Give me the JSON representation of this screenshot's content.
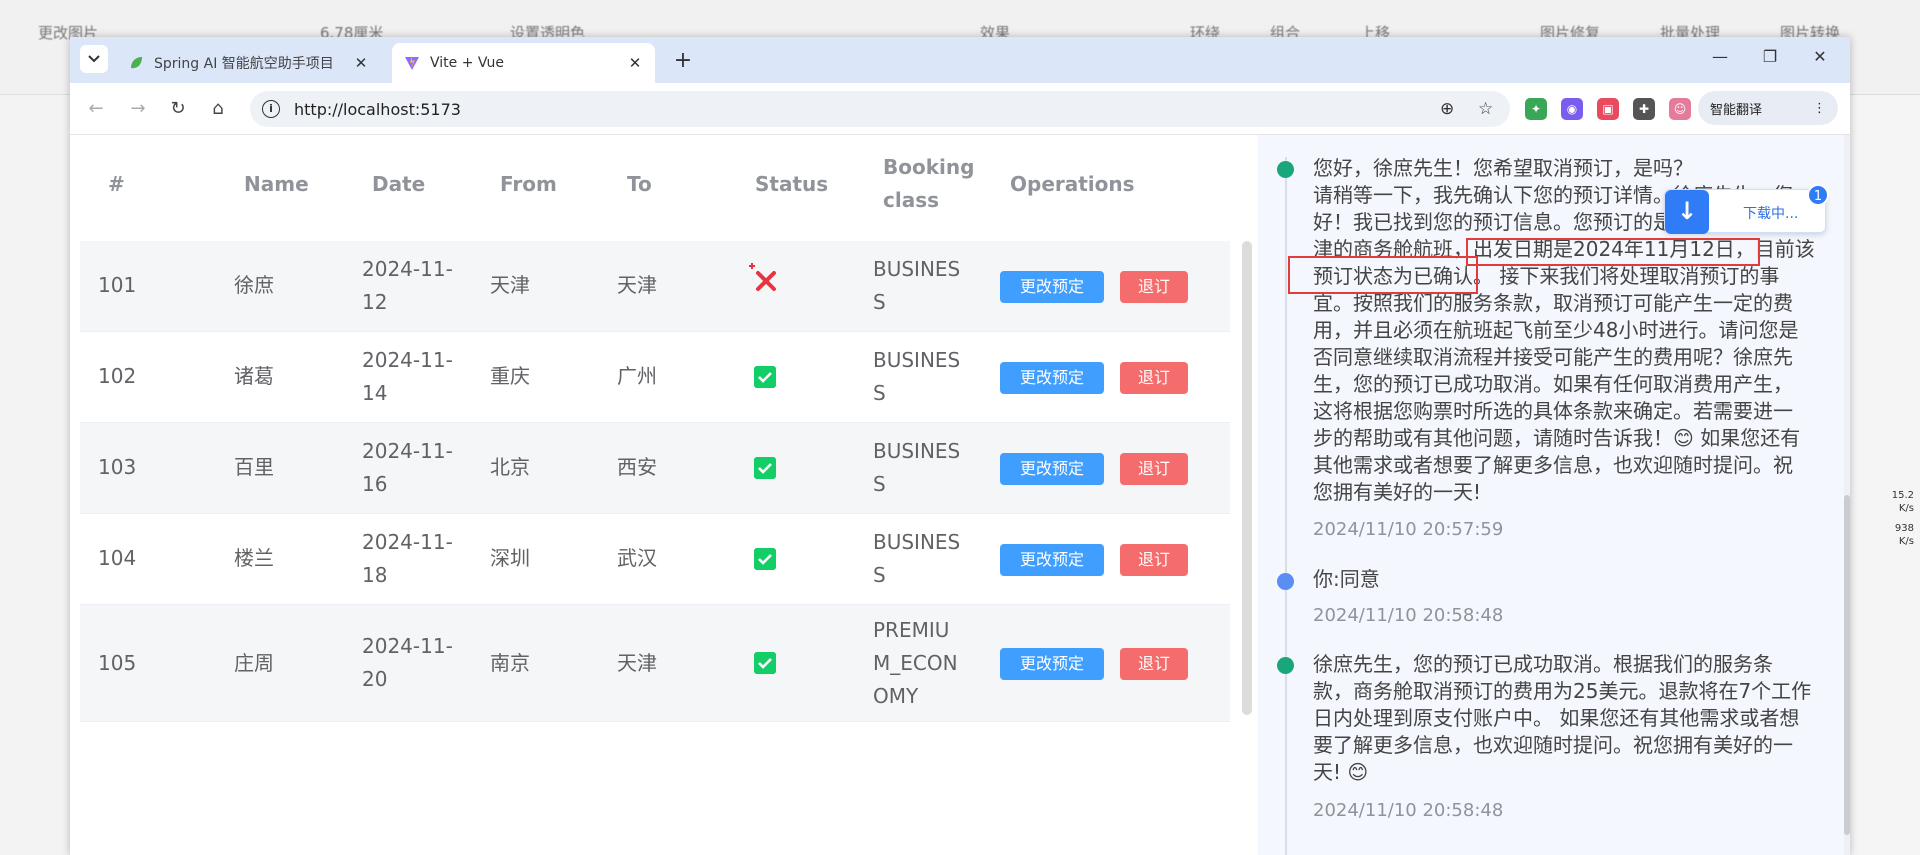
{
  "background_toolbar": {
    "items": [
      "更改图片",
      "6.78厘米",
      "设置透明色",
      "效果",
      "环绕",
      "组合",
      "上移",
      "图片修复",
      "批量处理",
      "图片转换"
    ]
  },
  "side_stats": {
    "upload": "15.2",
    "upload_unit": "K/s",
    "download": "938",
    "download_unit": "K/s"
  },
  "browser": {
    "tabs": [
      {
        "label": "Spring AI 智能航空助手项目",
        "active": false
      },
      {
        "label": "Vite + Vue",
        "active": true
      }
    ],
    "new_tab": "+",
    "url": "http://localhost:5173",
    "ext_button_label": "智能翻译"
  },
  "download_popup": {
    "label": "下载中...",
    "badge": "1"
  },
  "table": {
    "headers": {
      "id": "#",
      "name": "Name",
      "date": "Date",
      "from": "From",
      "to": "To",
      "status": "Status",
      "booking_class_line1": "Booking",
      "booking_class_line2": "class",
      "operations": "Operations"
    },
    "rows": [
      {
        "id": "101",
        "name": "徐庶",
        "date_l1": "2024-11-",
        "date_l2": "12",
        "from": "天津",
        "to": "天津",
        "status": "cancelled",
        "class_l1": "BUSINES",
        "class_l2": "S",
        "class_l3": "",
        "edit": "更改预定",
        "cancel": "退订"
      },
      {
        "id": "102",
        "name": "诸葛",
        "date_l1": "2024-11-",
        "date_l2": "14",
        "from": "重庆",
        "to": "广州",
        "status": "confirmed",
        "class_l1": "BUSINES",
        "class_l2": "S",
        "class_l3": "",
        "edit": "更改预定",
        "cancel": "退订"
      },
      {
        "id": "103",
        "name": "百里",
        "date_l1": "2024-11-",
        "date_l2": "16",
        "from": "北京",
        "to": "西安",
        "status": "confirmed",
        "class_l1": "BUSINES",
        "class_l2": "S",
        "class_l3": "",
        "edit": "更改预定",
        "cancel": "退订"
      },
      {
        "id": "104",
        "name": "楼兰",
        "date_l1": "2024-11-",
        "date_l2": "18",
        "from": "深圳",
        "to": "武汉",
        "status": "confirmed",
        "class_l1": "BUSINES",
        "class_l2": "S",
        "class_l3": "",
        "edit": "更改预定",
        "cancel": "退订"
      },
      {
        "id": "105",
        "name": "庄周",
        "date_l1": "2024-11-",
        "date_l2": "20",
        "from": "南京",
        "to": "天津",
        "status": "confirmed",
        "class_l1": "PREMIU",
        "class_l2": "M_ECON",
        "class_l3": "OMY",
        "edit": "更改预定",
        "cancel": "退订"
      }
    ]
  },
  "chat": {
    "messages": [
      {
        "role": "assistant",
        "lines": [
          "您好，徐庶先生！您希望取消预订，是吗？",
          "请稍等一下，我先确认下您的预订详情。徐庶先生，您",
          "好！我已找到您的预订信息。您预订的是从天津飞往天",
          "津的商务舱航班，出发日期是2024年11月12日，目前该",
          "预订状态为已确认。 接下来我们将处理取消预订的事",
          "宜。按照我们的服务条款，取消预订可能产生一定的费",
          "用，并且必须在航班起飞前至少48小时进行。请问您是",
          "否同意继续取消流程并接受可能产生的费用呢？徐庶先",
          "生，您的预订已成功取消。如果有任何取消费用产生，",
          "这将根据您购票时所选的具体条款来确定。若需要进一",
          "步的帮助或有其他问题，请随时告诉我！😊 如果您还有",
          "其他需求或者想要了解更多信息，也欢迎随时提问。祝",
          "您拥有美好的一天!"
        ],
        "time": "2024/11/10 20:57:59"
      },
      {
        "role": "user",
        "lines": [
          "你:同意"
        ],
        "time": "2024/11/10 20:58:48"
      },
      {
        "role": "assistant",
        "lines": [
          "徐庶先生，您的预订已成功取消。根据我们的服务条",
          "款，商务舱取消预订的费用为25美元。退款将在7个工作",
          "日内处理到原支付账户中。 如果您还有其他需求或者想",
          "要了解更多信息，也欢迎随时提问。祝您拥有美好的一",
          "天! 😊"
        ],
        "time": "2024/11/10 20:58:48"
      }
    ]
  },
  "colors": {
    "primary": "#409eff",
    "danger": "#f56c6c",
    "success": "#13ce66",
    "tabbar": "#dbe6f8",
    "chat_bg": "#f4f7fd",
    "annotation_red": "#e23b3b"
  }
}
